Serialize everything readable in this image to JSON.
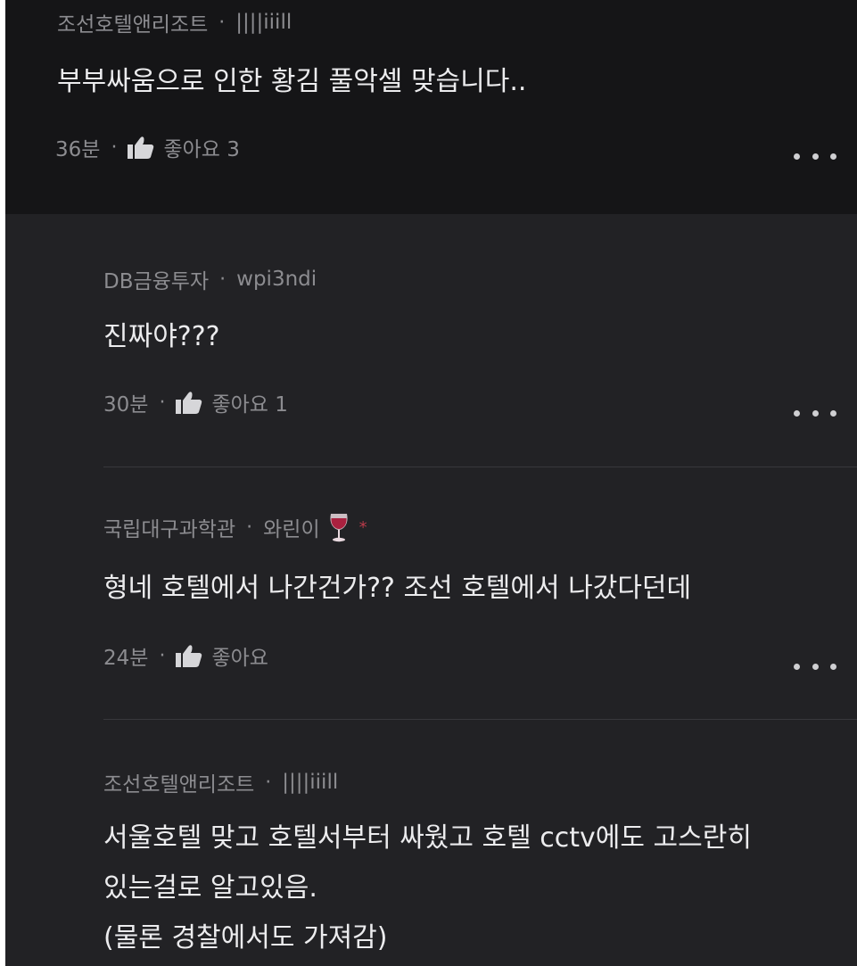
{
  "comments": [
    {
      "author": "조선호텔앤리조트",
      "handle": "||||iiill",
      "text_lines": [
        "부부싸움으로 인한 황김 풀악셀 맞습니다.."
      ],
      "time": "36분",
      "likes": "좋아요 3"
    },
    {
      "author": "DB금융투자",
      "handle": "wpi3ndi",
      "text_lines": [
        "진짜야???"
      ],
      "time": "30분",
      "likes": "좋아요 1"
    },
    {
      "author": "국립대구과학관",
      "handle": "와린이",
      "badge_icon": "wine-glass-icon",
      "badge_marker": "*",
      "text_lines": [
        "형네 호텔에서 나간건가?? 조선 호텔에서 나갔다던데"
      ],
      "time": "24분",
      "likes": "좋아요"
    },
    {
      "author": "조선호텔앤리조트",
      "handle": "||||iiill",
      "text_lines": [
        "서울호텔 맞고 호텔서부터 싸웠고 호텔 cctv에도 고스란히",
        "있는걸로 알고있음.",
        "(물론 경찰에서도 가져감)"
      ]
    }
  ],
  "separator": "·",
  "icons": {
    "like": "thumbs-up-icon",
    "more": "more-options-icon"
  },
  "colors": {
    "top_bg": "#151517",
    "reply_bg": "#222225",
    "meta_text": "#8c8c90",
    "body_text": "#ececee",
    "badge_star": "#b93a4a"
  }
}
